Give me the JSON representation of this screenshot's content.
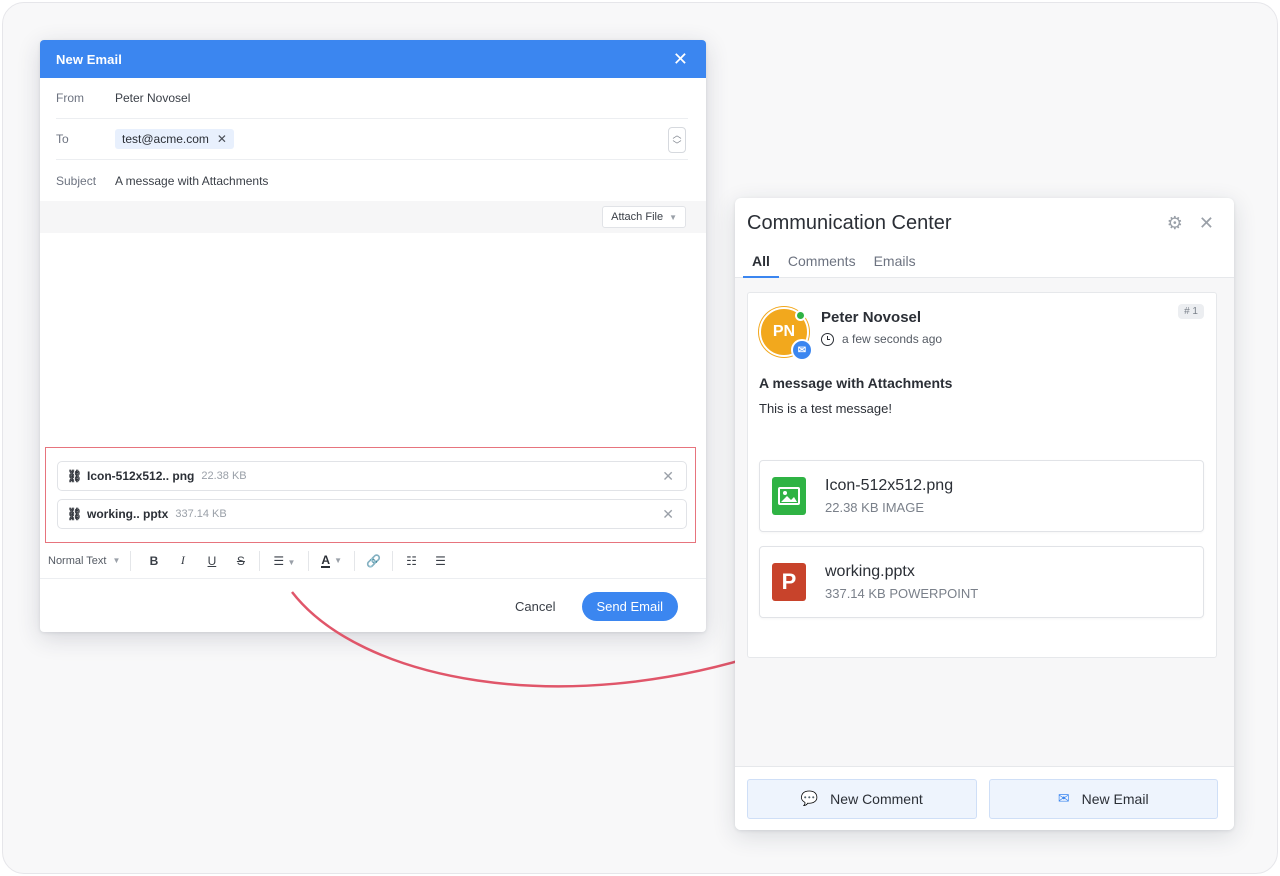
{
  "compose": {
    "title": "New Email",
    "from_label": "From",
    "from_value": "Peter Novosel",
    "to_label": "To",
    "to_chip": "test@acme.com",
    "subject_label": "Subject",
    "subject_value": "A message with Attachments",
    "attach_button": "Attach File",
    "attachments": [
      {
        "name": "Icon-512x512.. png",
        "size": "22.38 KB"
      },
      {
        "name": "working.. pptx",
        "size": "337.14 KB"
      }
    ],
    "toolbar": {
      "text_style": "Normal Text",
      "bold": "B",
      "italic": "I",
      "underline": "U",
      "strike": "S",
      "font_color": "A"
    },
    "cancel": "Cancel",
    "send": "Send Email"
  },
  "cc": {
    "title": "Communication Center",
    "tabs": [
      "All",
      "Comments",
      "Emails"
    ],
    "entry": {
      "initials": "PN",
      "author": "Peter Novosel",
      "time": "a few seconds ago",
      "number": "# 1",
      "subject": "A message with Attachments",
      "body": "This is a test message!",
      "files": [
        {
          "name": "Icon-512x512.png",
          "meta": "22.38 KB IMAGE",
          "icon": "image-file-icon"
        },
        {
          "name": "working.pptx",
          "meta": "337.14 KB POWERPOINT",
          "icon": "powerpoint-file-icon"
        }
      ]
    },
    "new_comment": "New Comment",
    "new_email": "New Email"
  },
  "colors": {
    "accent": "#3b86f0",
    "highlight_border": "#e7747d",
    "arrow": "#e0566a",
    "avatar": "#f2a81d",
    "online": "#2fb344",
    "ppt": "#c8432b"
  }
}
